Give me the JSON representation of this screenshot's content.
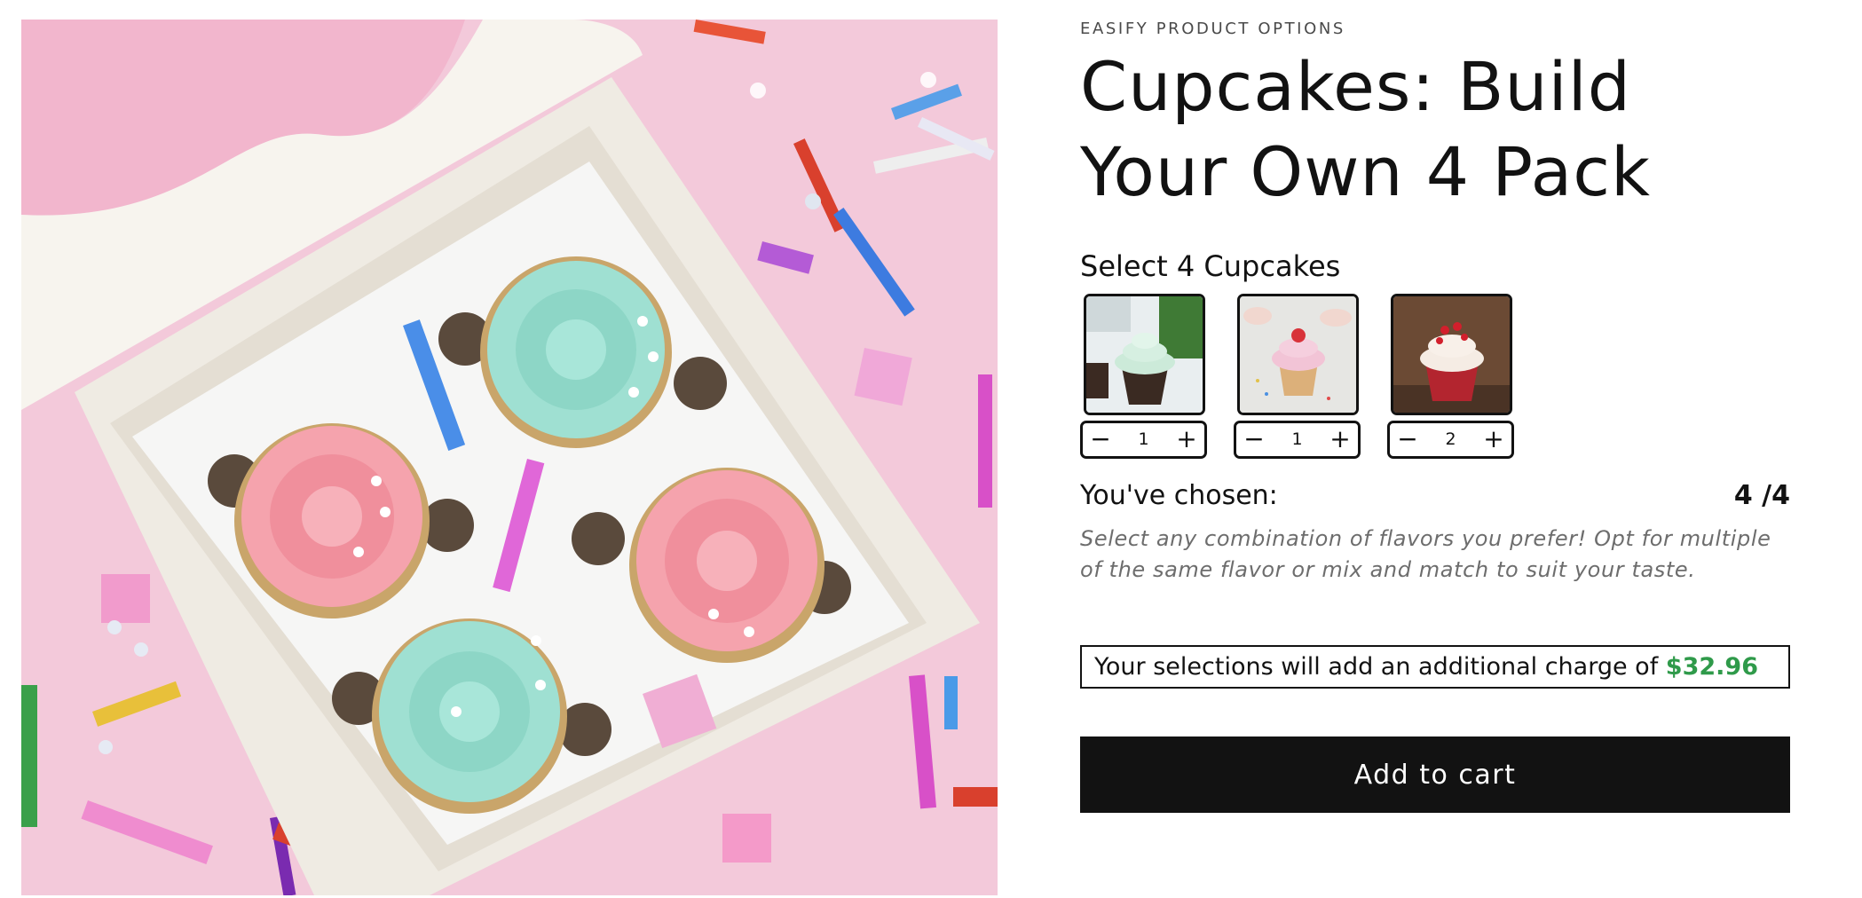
{
  "product": {
    "vendor": "EASIFY PRODUCT OPTIONS",
    "title": "Cupcakes: Build Your Own 4 Pack",
    "image_alt": "Four cupcakes with pink and mint frosting in an open white box on pink confetti background"
  },
  "option": {
    "label": "Select 4 Cupcakes",
    "swatches": [
      {
        "name": "chocolate-cupcake",
        "quantity": "1",
        "minus": "−",
        "plus": "+"
      },
      {
        "name": "strawberry-cupcake",
        "quantity": "1",
        "minus": "−",
        "plus": "+"
      },
      {
        "name": "red-velvet-cupcake",
        "quantity": "2",
        "minus": "−",
        "plus": "+"
      }
    ]
  },
  "chosen": {
    "label": "You've chosen:",
    "count": "4 /4"
  },
  "help_text": "Select any combination of flavors you prefer! Opt for multiple of the same flavor or mix and match to suit your taste.",
  "charge": {
    "text": "Your selections will add an additional charge of",
    "amount": "$32.96",
    "amount_color": "#2f9a4a"
  },
  "cart": {
    "add_label": "Add to cart",
    "button_color": "#121212"
  }
}
